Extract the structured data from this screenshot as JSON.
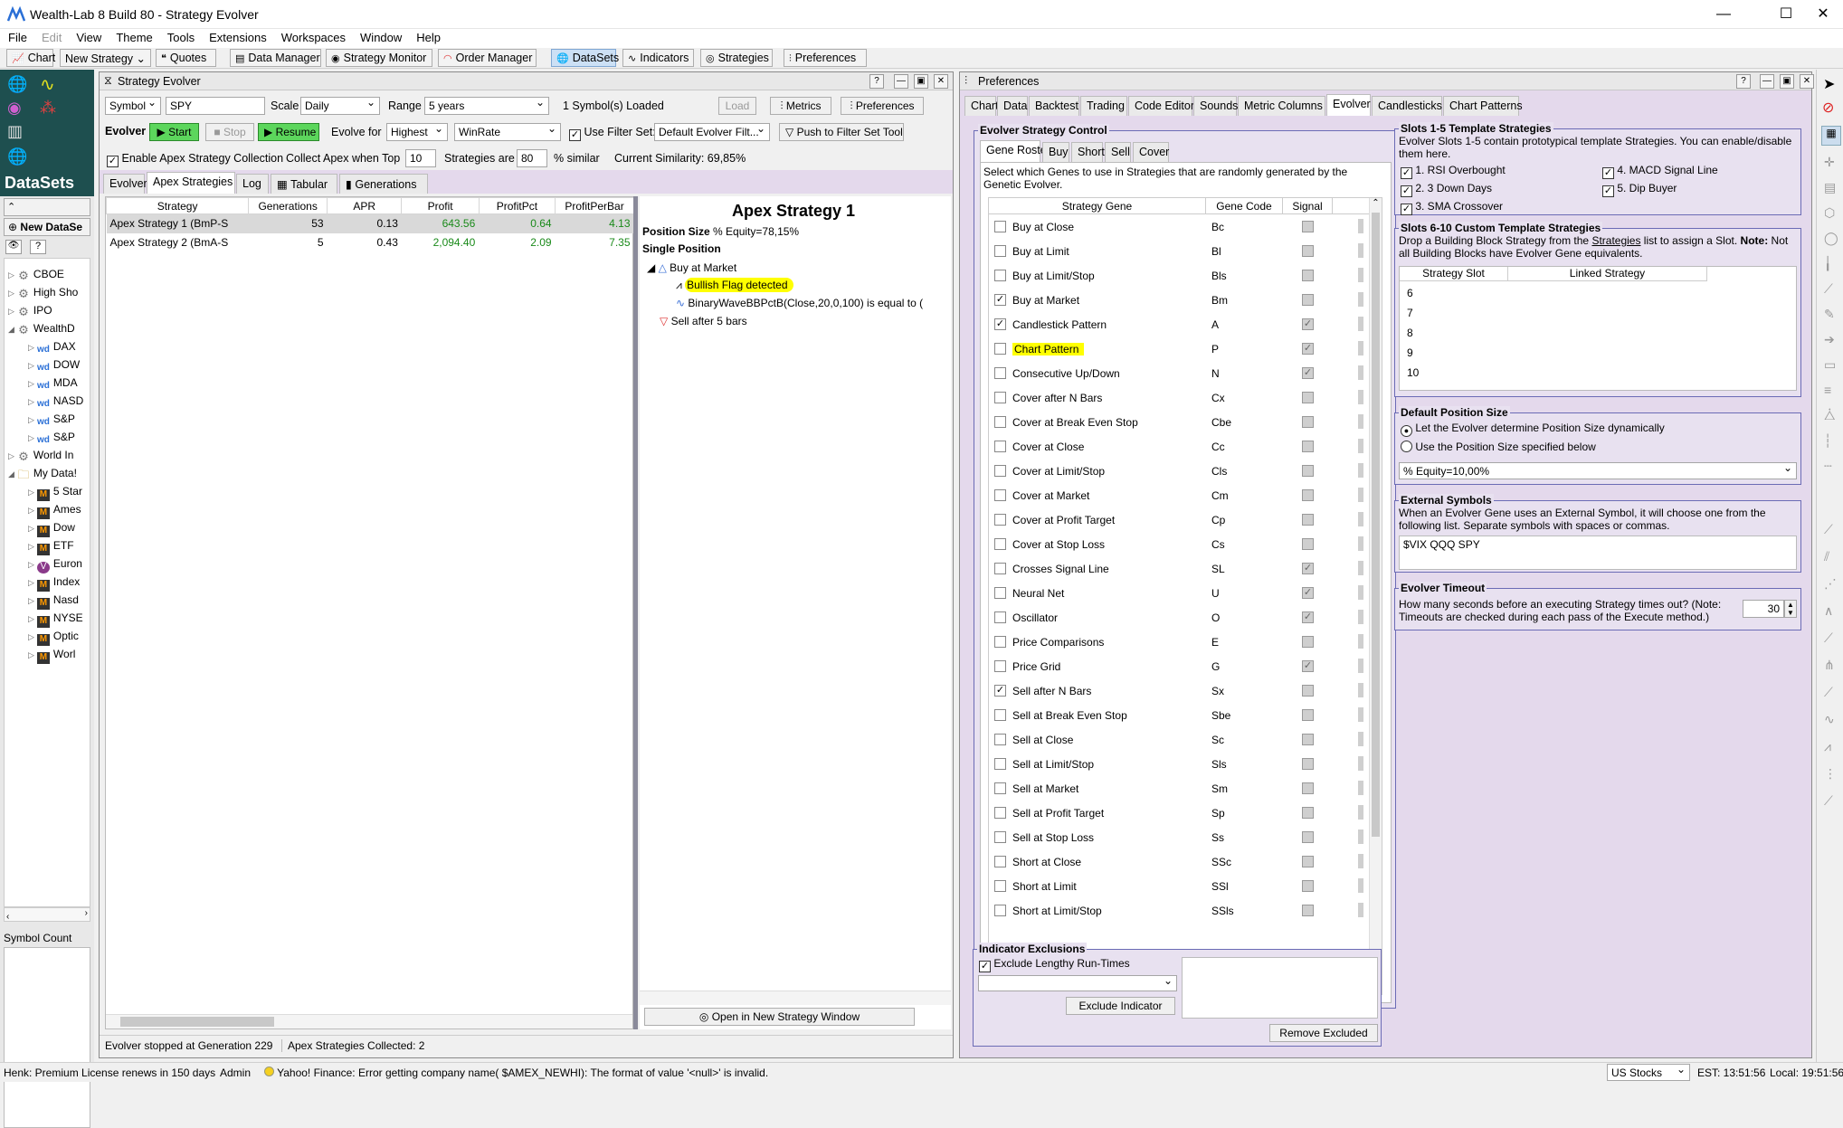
{
  "app": {
    "title": "Wealth-Lab 8 Build 80 - Strategy Evolver"
  },
  "menu": [
    "File",
    "Edit",
    "View",
    "Theme",
    "Tools",
    "Extensions",
    "Workspaces",
    "Window",
    "Help"
  ],
  "toolbar": {
    "chart": "Chart",
    "new_strategy": "New Strategy",
    "quotes": "Quotes",
    "data_manager": "Data Manager",
    "strategy_monitor": "Strategy Monitor",
    "order_manager": "Order Manager",
    "datasets": "DataSets",
    "indicators": "Indicators",
    "strategies": "Strategies",
    "preferences": "Preferences"
  },
  "left": {
    "title": "DataSets",
    "new_dataset": "New DataSe",
    "symbol_count": "Symbol Count",
    "tree": [
      {
        "label": "CBOE",
        "level": 0,
        "icon": "gear"
      },
      {
        "label": "High Sho",
        "level": 0,
        "icon": "gear"
      },
      {
        "label": "IPO",
        "level": 0,
        "icon": "gear"
      },
      {
        "label": "WealthD",
        "level": 0,
        "icon": "gear",
        "open": true
      },
      {
        "label": "DAX",
        "level": 1,
        "icon": "wd"
      },
      {
        "label": "DOW",
        "level": 1,
        "icon": "wd"
      },
      {
        "label": "MDA",
        "level": 1,
        "icon": "wd"
      },
      {
        "label": "NASD",
        "level": 1,
        "icon": "wd"
      },
      {
        "label": "S&P",
        "level": 1,
        "icon": "wd"
      },
      {
        "label": "S&P",
        "level": 1,
        "icon": "wd"
      },
      {
        "label": "World In",
        "level": 0,
        "icon": "gear"
      },
      {
        "label": "My Data!",
        "level": 0,
        "icon": "folder",
        "open": true
      },
      {
        "label": "5 Star",
        "level": 1,
        "icon": "m"
      },
      {
        "label": "Ames",
        "level": 1,
        "icon": "m"
      },
      {
        "label": "Dow",
        "level": 1,
        "icon": "m"
      },
      {
        "label": "ETF",
        "level": 1,
        "icon": "m"
      },
      {
        "label": "Euron",
        "level": 1,
        "icon": "v"
      },
      {
        "label": "Index",
        "level": 1,
        "icon": "m"
      },
      {
        "label": "Nasd",
        "level": 1,
        "icon": "m"
      },
      {
        "label": "NYSE",
        "level": 1,
        "icon": "m"
      },
      {
        "label": "Optic",
        "level": 1,
        "icon": "m"
      },
      {
        "label": "Worl",
        "level": 1,
        "icon": "m"
      }
    ]
  },
  "evolver": {
    "title": "Strategy Evolver",
    "symbol_mode": "Symbol",
    "symbol": "SPY",
    "scale_label": "Scale",
    "scale": "Daily",
    "range_label": "Range",
    "range": "5 years",
    "loaded": "1 Symbol(s) Loaded",
    "load": "Load",
    "metrics": "Metrics",
    "preferences": "Preferences",
    "evolver_label": "Evolver",
    "start": "Start",
    "stop": "Stop",
    "resume": "Resume",
    "evolve_for": "Evolve for",
    "highest": "Highest",
    "metric": "WinRate",
    "use_filter": "Use Filter Set:",
    "filter_set": "Default Evolver Filt...",
    "push_filter": "Push to Filter Set Tool",
    "enable_apex": "Enable Apex Strategy Collection",
    "collect_apex": "Collect Apex when Top",
    "top_n": "10",
    "strategies_are": "Strategies are",
    "similar_pct": "80",
    "similar_label": "% similar",
    "current_sim": "Current Similarity: 69,85%",
    "tabs": [
      "Evolver",
      "Apex Strategies",
      "Log",
      "Tabular",
      "Generations"
    ],
    "columns": [
      "Strategy",
      "Generations",
      "APR",
      "Profit",
      "ProfitPct",
      "ProfitPerBar"
    ],
    "rows": [
      {
        "strategy": "Apex Strategy 1 (BmP-S",
        "gen": "53",
        "apr": "0.13",
        "profit": "643.56",
        "pct": "0.64",
        "ppb": "4.13"
      },
      {
        "strategy": "Apex Strategy 2 (BmA-S",
        "gen": "5",
        "apr": "0.43",
        "profit": "2,094.40",
        "pct": "2.09",
        "ppb": "7.35"
      }
    ],
    "detail": {
      "title": "Apex Strategy 1",
      "possize_label": "Position Size",
      "possize": "% Equity=78,15%",
      "single": "Single Position",
      "buy": "Buy at Market",
      "cond1": "Bullish Flag detected",
      "cond2": "BinaryWaveBBPctB(Close,20,0,100) is equal to (",
      "sell": "Sell after 5 bars",
      "open_btn": "Open in New Strategy Window"
    },
    "status1": "Evolver stopped at Generation 229",
    "status2": "Apex Strategies Collected: 2"
  },
  "prefs": {
    "title": "Preferences",
    "tabs": [
      "Chart",
      "Data",
      "Backtest",
      "Trading",
      "Code Editor",
      "Sounds",
      "Metric Columns",
      "Evolver",
      "Candlesticks",
      "Chart Patterns"
    ],
    "esc_title": "Evolver Strategy Control",
    "subtabs": [
      "Gene Roster",
      "Buy",
      "Short",
      "Sell",
      "Cover"
    ],
    "esc_desc": "Select which Genes to use in Strategies that are randomly generated by the Genetic Evolver.",
    "gene_cols": [
      "Strategy Gene",
      "Gene Code",
      "Signal"
    ],
    "genes": [
      {
        "name": "Buy at Close",
        "code": "Bc",
        "on": false,
        "sig": false
      },
      {
        "name": "Buy at Limit",
        "code": "Bl",
        "on": false,
        "sig": false
      },
      {
        "name": "Buy at Limit/Stop",
        "code": "Bls",
        "on": false,
        "sig": false
      },
      {
        "name": "Buy at Market",
        "code": "Bm",
        "on": true,
        "sig": false
      },
      {
        "name": "Candlestick Pattern",
        "code": "A",
        "on": true,
        "sig": true
      },
      {
        "name": "Chart Pattern",
        "code": "P",
        "on": false,
        "sig": true,
        "hl": true
      },
      {
        "name": "Consecutive Up/Down",
        "code": "N",
        "on": false,
        "sig": true
      },
      {
        "name": "Cover after N Bars",
        "code": "Cx",
        "on": false,
        "sig": false
      },
      {
        "name": "Cover at Break Even Stop",
        "code": "Cbe",
        "on": false,
        "sig": false
      },
      {
        "name": "Cover at Close",
        "code": "Cc",
        "on": false,
        "sig": false
      },
      {
        "name": "Cover at Limit/Stop",
        "code": "Cls",
        "on": false,
        "sig": false
      },
      {
        "name": "Cover at Market",
        "code": "Cm",
        "on": false,
        "sig": false
      },
      {
        "name": "Cover at Profit Target",
        "code": "Cp",
        "on": false,
        "sig": false
      },
      {
        "name": "Cover at Stop Loss",
        "code": "Cs",
        "on": false,
        "sig": false
      },
      {
        "name": "Crosses Signal Line",
        "code": "SL",
        "on": false,
        "sig": true
      },
      {
        "name": "Neural Net",
        "code": "U",
        "on": false,
        "sig": true
      },
      {
        "name": "Oscillator",
        "code": "O",
        "on": false,
        "sig": true
      },
      {
        "name": "Price Comparisons",
        "code": "E",
        "on": false,
        "sig": false
      },
      {
        "name": "Price Grid",
        "code": "G",
        "on": false,
        "sig": true
      },
      {
        "name": "Sell after N Bars",
        "code": "Sx",
        "on": true,
        "sig": false
      },
      {
        "name": "Sell at Break Even Stop",
        "code": "Sbe",
        "on": false,
        "sig": false
      },
      {
        "name": "Sell at Close",
        "code": "Sc",
        "on": false,
        "sig": false
      },
      {
        "name": "Sell at Limit/Stop",
        "code": "Sls",
        "on": false,
        "sig": false
      },
      {
        "name": "Sell at Market",
        "code": "Sm",
        "on": false,
        "sig": false
      },
      {
        "name": "Sell at Profit Target",
        "code": "Sp",
        "on": false,
        "sig": false
      },
      {
        "name": "Sell at Stop Loss",
        "code": "Ss",
        "on": false,
        "sig": false
      },
      {
        "name": "Short at Close",
        "code": "SSc",
        "on": false,
        "sig": false
      },
      {
        "name": "Short at Limit",
        "code": "SSl",
        "on": false,
        "sig": false
      },
      {
        "name": "Short at Limit/Stop",
        "code": "SSls",
        "on": false,
        "sig": false
      }
    ],
    "ind_excl": {
      "title": "Indicator Exclusions",
      "lengthy": "Exclude Lengthy Run-Times",
      "exclude_btn": "Exclude Indicator",
      "remove_btn": "Remove Excluded"
    },
    "slots15": {
      "title": "Slots 1-5 Template Strategies",
      "desc": "Evolver Slots 1-5 contain prototypical template Strategies. You can enable/disable them here.",
      "items": [
        "1. RSI Overbought",
        "2. 3 Down Days",
        "3. SMA Crossover",
        "4. MACD Signal Line",
        "5. Dip Buyer"
      ]
    },
    "slots610": {
      "title": "Slots 6-10 Custom Template Strategies",
      "desc_a": "Drop a Building Block Strategy from the ",
      "desc_link": "Strategies",
      "desc_b": " list to assign a Slot. ",
      "desc_note": "Note:",
      "desc_c": " Not all Building Blocks have Evolver Gene equivalents.",
      "cols": [
        "Strategy Slot",
        "Linked Strategy"
      ],
      "slots": [
        "6",
        "7",
        "8",
        "9",
        "10"
      ]
    },
    "dps": {
      "title": "Default Position Size",
      "opt1": "Let the Evolver determine Position Size dynamically",
      "opt2": "Use the Position Size specified below",
      "value": "% Equity=10,00%"
    },
    "ext": {
      "title": "External Symbols",
      "desc": "When an Evolver Gene uses an External Symbol, it will choose one from the following list. Separate symbols with spaces or commas.",
      "value": "$VIX QQQ SPY"
    },
    "timeout": {
      "title": "Evolver Timeout",
      "desc": "How many seconds before an executing Strategy times out? (Note: Timeouts are checked during each pass of the Execute method.)",
      "value": "30"
    }
  },
  "status": {
    "license": "Henk: Premium License renews in 150 days",
    "user": "Admin",
    "msg": "Yahoo! Finance: Error getting company name( $AMEX_NEWHI): The format of value '<null>' is invalid.",
    "market": "US Stocks",
    "est": "EST: 13:51:56",
    "local": "Local: 19:51:56"
  }
}
